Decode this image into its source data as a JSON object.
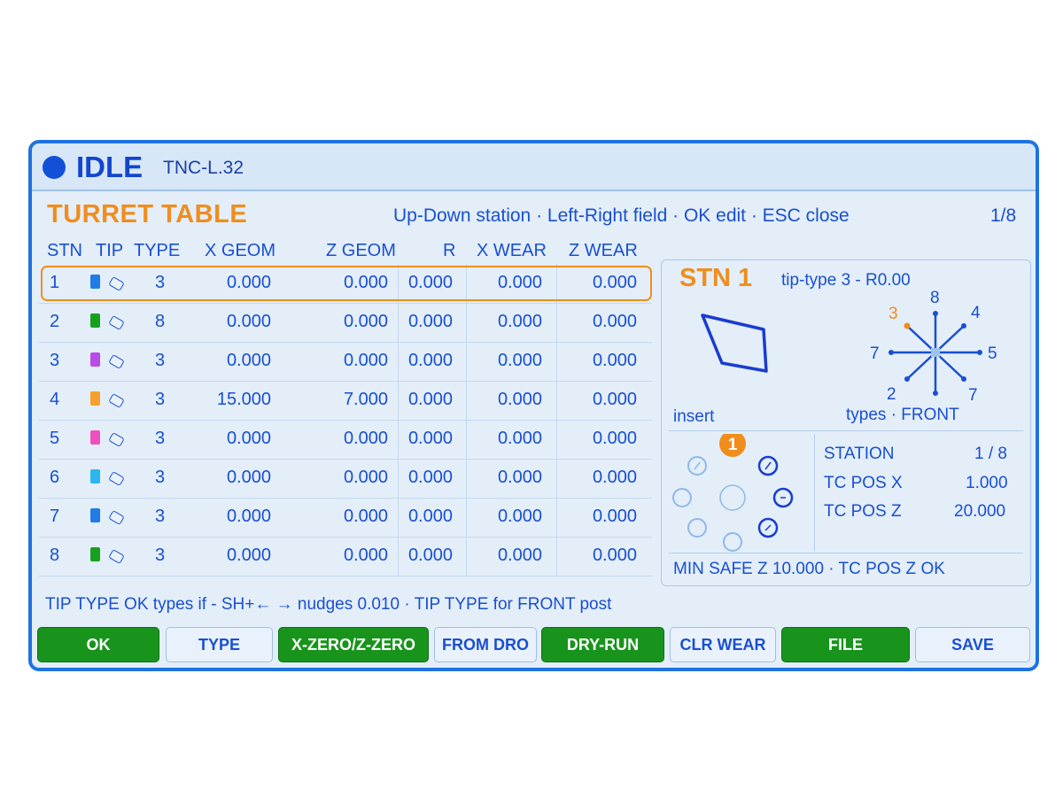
{
  "title_bar": {
    "state": "IDLE",
    "machine": "TNC-L.32"
  },
  "heading": "TURRET TABLE",
  "help_hint": "Up-Down station · Left-Right field · OK edit · ESC close",
  "page_indicator": "1/8",
  "columns": [
    "STN",
    "TIP",
    "TYPE",
    "X GEOM",
    "Z GEOM",
    "R",
    "X WEAR",
    "Z WEAR"
  ],
  "rows": [
    {
      "stn": "1",
      "color": "#1f7be6",
      "type": "3",
      "x_geom": "0.000",
      "z_geom": "0.000",
      "r": "0.000",
      "x_wear": "0.000",
      "z_wear": "0.000"
    },
    {
      "stn": "2",
      "color": "#17a01e",
      "type": "8",
      "x_geom": "0.000",
      "z_geom": "0.000",
      "r": "0.000",
      "x_wear": "0.000",
      "z_wear": "0.000"
    },
    {
      "stn": "3",
      "color": "#b94be6",
      "type": "3",
      "x_geom": "0.000",
      "z_geom": "0.000",
      "r": "0.000",
      "x_wear": "0.000",
      "z_wear": "0.000"
    },
    {
      "stn": "4",
      "color": "#f5a02a",
      "type": "3",
      "x_geom": "15.000",
      "z_geom": "7.000",
      "r": "0.000",
      "x_wear": "0.000",
      "z_wear": "0.000"
    },
    {
      "stn": "5",
      "color": "#f04fc0",
      "type": "3",
      "x_geom": "0.000",
      "z_geom": "0.000",
      "r": "0.000",
      "x_wear": "0.000",
      "z_wear": "0.000"
    },
    {
      "stn": "6",
      "color": "#2ab6ef",
      "type": "3",
      "x_geom": "0.000",
      "z_geom": "0.000",
      "r": "0.000",
      "x_wear": "0.000",
      "z_wear": "0.000"
    },
    {
      "stn": "7",
      "color": "#1f7be6",
      "type": "3",
      "x_geom": "0.000",
      "z_geom": "0.000",
      "r": "0.000",
      "x_wear": "0.000",
      "z_wear": "0.000"
    },
    {
      "stn": "8",
      "color": "#17a01e",
      "type": "3",
      "x_geom": "0.000",
      "z_geom": "0.000",
      "r": "0.000",
      "x_wear": "0.000",
      "z_wear": "0.000"
    }
  ],
  "selected_row": 1,
  "detail": {
    "station_title": "STN 1",
    "tip_type": "tip-type 3 - R0.00",
    "insert_label": "insert",
    "types_label": "types · FRONT",
    "compass": {
      "n": "8",
      "ne": "4",
      "e": "5",
      "se": "7",
      "s": "",
      "sw": "2",
      "w": "7",
      "nw": "3",
      "active": "3"
    },
    "turret_active": "1",
    "station_label": "STATION",
    "station_value": "1 / 8",
    "tc_pos_x_label": "TC POS X",
    "tc_pos_x_value": "1.000",
    "tc_pos_z_label": "TC POS Z",
    "tc_pos_z_value": "20.000",
    "safety": "MIN SAFE Z 10.000 · TC POS Z OK"
  },
  "bottom_hint": "TIP TYPE  OK types if - SH+← → nudges 0.010  · TIP TYPE for FRONT post",
  "buttons": [
    "OK",
    "TYPE",
    "X-ZERO/Z-ZERO",
    "FROM DRO",
    "DRY-RUN",
    "CLR WEAR",
    "FILE",
    "SAVE"
  ],
  "colors": {
    "accent": "#f08d1d",
    "text": "#1a4fd0",
    "border": "#1e73e0",
    "ok_green": "#18941c",
    "panel_bg": "#e3eef9"
  }
}
